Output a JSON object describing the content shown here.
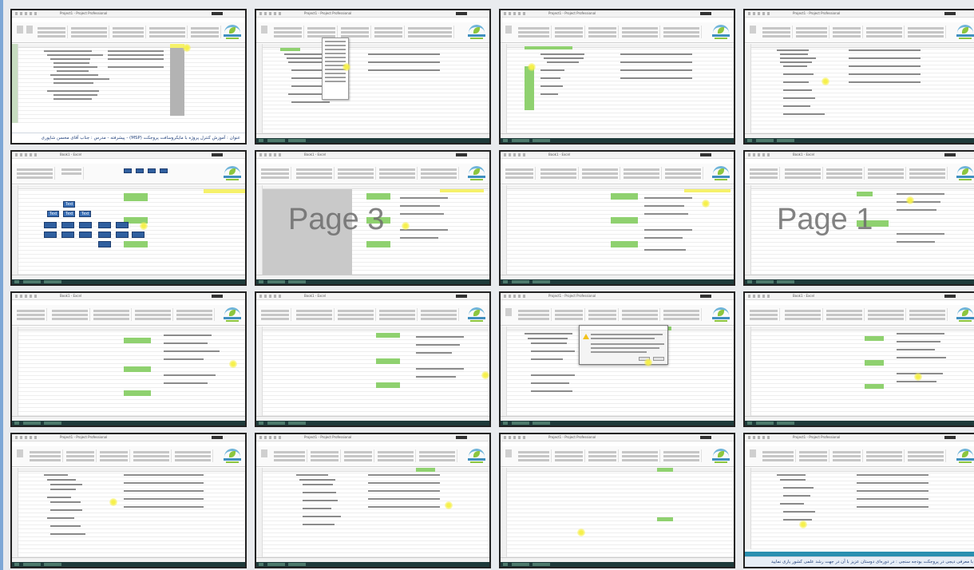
{
  "app": {
    "window_title": "Project1 - Project Professional",
    "window_title_excel": "Book1 - Excel"
  },
  "watermarks": {
    "page3": "Page 3",
    "page1": "Page 1"
  },
  "captions": {
    "top": "عنوان : آموزش کنترل پروژه با مایکروسافت پروجکت (MSP) - پیشرفته - مدرس : جناب آقای محسن شاپوری",
    "bottom": "با معرفی دیجی در پروجکت بودجه سنجی : در دوره‌ای دوستان عزیز با آن در جهت رشد علمی کشور یاری نمایید"
  },
  "chart_labels": [
    "Text",
    "Text",
    "Text",
    "Text"
  ],
  "colors": {
    "green_highlight": "#8fd16f",
    "selection_gray": "#b3b3b3",
    "header_yellow": "#f5f16a",
    "taskbar": "#1e3a3a",
    "brand_blue": "#3f8fbf",
    "brand_green": "#8cc63e"
  },
  "icons": [
    "logo-icon",
    "warning-icon",
    "cursor-highlight-icon",
    "windows-start-icon"
  ]
}
